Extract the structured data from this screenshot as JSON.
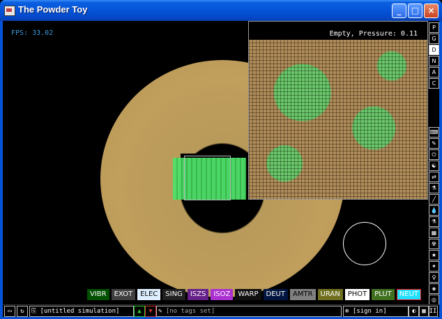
{
  "window": {
    "title": "The Powder Toy",
    "min": "_",
    "max": "□",
    "close": "×"
  },
  "sim": {
    "fps": "FPS: 33.02",
    "status": "Empty, Pressure: 0.11"
  },
  "sidebar_top": [
    "P",
    "G",
    "D",
    "N",
    "A",
    "C"
  ],
  "sidebar_tools": [
    "⌨",
    "✎",
    "⏻",
    "☯",
    "⇄",
    "⚗",
    "╱",
    "💧",
    "⚗",
    "▦",
    "☢",
    "★",
    "✦",
    "♀",
    "◈",
    "◎",
    "▤"
  ],
  "elements": [
    {
      "name": "VIBR",
      "bg": "#005000",
      "fg": "#fff"
    },
    {
      "name": "EXOT",
      "bg": "#404040",
      "fg": "#fff"
    },
    {
      "name": "ELEC",
      "bg": "#dfefff",
      "fg": "#000"
    },
    {
      "name": "SING",
      "bg": "#202020",
      "fg": "#fff"
    },
    {
      "name": "ISZS",
      "bg": "#662089",
      "fg": "#fff"
    },
    {
      "name": "ISOZ",
      "bg": "#aa30d0",
      "fg": "#fff"
    },
    {
      "name": "WARP",
      "bg": "#101010",
      "fg": "#fff"
    },
    {
      "name": "DEUT",
      "bg": "#00153f",
      "fg": "#fff"
    },
    {
      "name": "AMTR",
      "bg": "#808080",
      "fg": "#000"
    },
    {
      "name": "URAN",
      "bg": "#707020",
      "fg": "#fff"
    },
    {
      "name": "PHOT",
      "bg": "#ffffff",
      "fg": "#000"
    },
    {
      "name": "PLUT",
      "bg": "#407020",
      "fg": "#fff"
    },
    {
      "name": "NEUT",
      "bg": "#20e0ff",
      "fg": "#fff"
    }
  ],
  "bottom": {
    "open_icon": "▭",
    "reload_icon": "↻",
    "save_icon": "⎘",
    "save_name": "[untitled simulation]",
    "vote_up": "▲",
    "vote_down": "▼",
    "tag_icon": "✎",
    "tags": "[no tags set]",
    "user_icon": "⊕",
    "signin": "[sign in]",
    "settings_icon": "◐",
    "renderer_icon": "▦",
    "pause_icon": "II"
  }
}
